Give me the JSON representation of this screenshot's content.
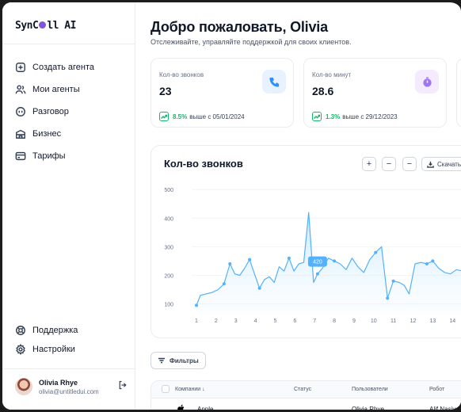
{
  "brand": {
    "logo_prefix": "SynC",
    "logo_suffix": "ll AI",
    "accent": "#7f56d9"
  },
  "sidebar": {
    "items": [
      {
        "label": "Создать агента",
        "icon": "plus-square-icon"
      },
      {
        "label": "Мои агенты",
        "icon": "users-icon"
      },
      {
        "label": "Разговор",
        "icon": "chat-icon"
      },
      {
        "label": "Бизнес",
        "icon": "building-icon"
      },
      {
        "label": "Тарифы",
        "icon": "credit-card-icon"
      }
    ],
    "bottom_items": [
      {
        "label": "Поддержка",
        "icon": "support-icon"
      },
      {
        "label": "Настройки",
        "icon": "gear-icon"
      }
    ],
    "user": {
      "name": "Olivia Rhye",
      "email": "olivia@untitledui.com"
    }
  },
  "header": {
    "title": "Добро пожаловать, Olivia",
    "subtitle": "Отслеживайте, управляйте поддержкой для своих клиентов."
  },
  "stats": [
    {
      "label": "Кол-во звонков",
      "value": "23",
      "trend_pct": "8.5%",
      "trend_text": "выше с 05/01/2024",
      "icon": "phone-icon",
      "icon_bg": "#e8f2ff",
      "icon_color": "#2e90fa"
    },
    {
      "label": "Кол-во минут",
      "value": "28.6",
      "trend_pct": "1.3%",
      "trend_text": "выше с 29/12/2023",
      "icon": "stopwatch-icon",
      "icon_bg": "#f4ebff",
      "icon_color": "#9e77ed"
    }
  ],
  "chart_toolbar": {
    "plus": "+",
    "minus1": "−",
    "minus2": "−",
    "download": "Скачать"
  },
  "chart_data": {
    "type": "area",
    "title": "Кол-во звонков",
    "x_ticks": [
      "1",
      "2",
      "3",
      "4",
      "5",
      "6",
      "7",
      "8",
      "9",
      "10",
      "11",
      "12",
      "13",
      "14"
    ],
    "y_ticks": [
      "100",
      "200",
      "300",
      "400",
      "500"
    ],
    "ylim": [
      60,
      520
    ],
    "xlim": [
      1,
      15.6
    ],
    "highlight": {
      "x": 7.15,
      "label": "420"
    },
    "series": [
      {
        "color": "#53b1fd",
        "x": [
          1,
          1.2,
          1.5,
          1.8,
          2.1,
          2.4,
          2.7,
          2.95,
          3.2,
          3.45,
          3.7,
          3.95,
          4.2,
          4.45,
          4.7,
          4.95,
          5.2,
          5.45,
          5.7,
          5.95,
          6.2,
          6.45,
          6.7,
          6.95,
          7.15,
          7.4,
          7.7,
          8.0,
          8.3,
          8.6,
          8.9,
          9.2,
          9.5,
          9.8,
          10.1,
          10.4,
          10.7,
          11.0,
          11.3,
          11.55,
          11.8,
          12.1,
          12.4,
          12.7,
          13.0,
          13.3,
          13.6,
          13.9,
          14.2,
          14.5,
          14.8,
          15.1,
          15.4
        ],
        "y": [
          95,
          130,
          135,
          140,
          150,
          170,
          240,
          205,
          200,
          225,
          255,
          205,
          155,
          185,
          195,
          175,
          230,
          215,
          260,
          215,
          240,
          245,
          420,
          175,
          205,
          225,
          260,
          250,
          240,
          220,
          260,
          230,
          210,
          255,
          280,
          300,
          120,
          180,
          175,
          165,
          135,
          240,
          245,
          240,
          250,
          225,
          210,
          205,
          220,
          215,
          230,
          225,
          230
        ]
      }
    ]
  },
  "filters_label": "Фильтры",
  "table": {
    "headers": [
      "Компании",
      "Статус",
      "Пользователи",
      "Робот"
    ],
    "rows": [
      {
        "company": "Apple",
        "status": "",
        "user": "Olivia Rhye",
        "robot": "Alif Nasiya"
      }
    ]
  }
}
